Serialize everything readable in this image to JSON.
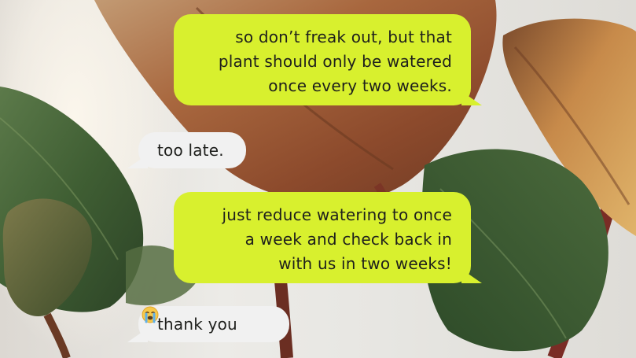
{
  "messages": [
    {
      "direction": "sent",
      "lines": [
        "so don’t freak out, but that",
        "plant should only be watered",
        "once every two weeks."
      ]
    },
    {
      "direction": "received",
      "text": "too late."
    },
    {
      "direction": "sent",
      "lines": [
        "just reduce watering to once",
        "a week and check back in",
        "with us in two weeks!"
      ]
    },
    {
      "direction": "received",
      "text": "thank you",
      "emoji": "crying-face-emoji"
    }
  ],
  "colors": {
    "sent_bubble": "#d8f02e",
    "received_bubble": "#f1f1f1",
    "text": "#1e1f1c"
  }
}
